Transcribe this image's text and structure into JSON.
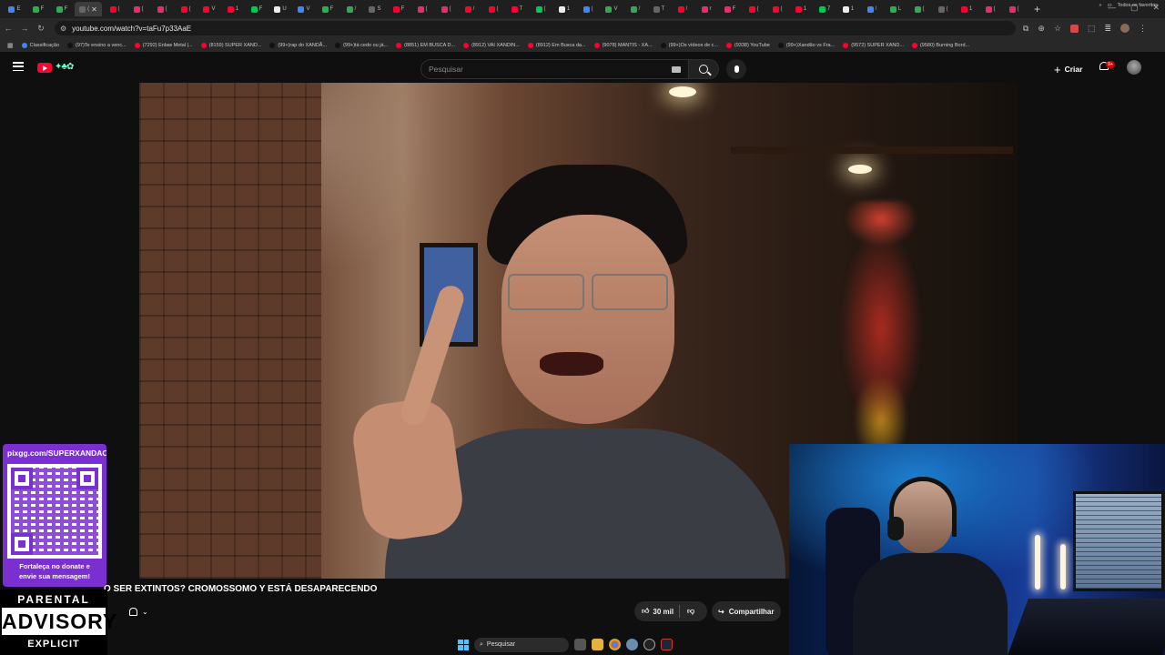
{
  "browser": {
    "tab_labels": [
      "E",
      "F",
      "F",
      "(",
      "(",
      "(",
      "(",
      "(",
      "V",
      "1",
      "F",
      "U",
      "V",
      "F",
      "/",
      "S",
      "F",
      "(",
      "(",
      "/",
      "(",
      "T",
      "(",
      "1",
      "(",
      "V",
      "/",
      "T",
      "/",
      "r",
      "F",
      "(",
      "(",
      "1",
      "7",
      "1",
      "/",
      "L",
      "(",
      "(",
      "1",
      "(",
      "("
    ],
    "active_tab_close": "✕",
    "new_tab": "+",
    "url": "youtube.com/watch?v=taFu7p33AaE",
    "bookmarks": [
      {
        "label": "Classificação",
        "color": "#4285f4"
      },
      {
        "label": "(97)Te ensino a venc...",
        "color": "#111111"
      },
      {
        "label": "(7292) Enlaw Metal |...",
        "color": "#ff0033"
      },
      {
        "label": "(8159) SUPER XAND...",
        "color": "#ff0033"
      },
      {
        "label": "(99+)rap do XANDÃ...",
        "color": "#111111"
      },
      {
        "label": "(99+)tá cedo ou já...",
        "color": "#111111"
      },
      {
        "label": "(8851) EM BUSCA D...",
        "color": "#ff0033"
      },
      {
        "label": "(8912) VAI XANDIN...",
        "color": "#ff0033"
      },
      {
        "label": "(8912) Em Busca da...",
        "color": "#ff0033"
      },
      {
        "label": "(9078) MANTIS - XA...",
        "color": "#ff0033"
      },
      {
        "label": "(99+)Os vídeos de c...",
        "color": "#111111"
      },
      {
        "label": "(9338) YouTube",
        "color": "#ff0033"
      },
      {
        "label": "(99+)Xandão vs Fra...",
        "color": "#111111"
      },
      {
        "label": "(9572) SUPER XAND...",
        "color": "#ff0033"
      },
      {
        "label": "(9580) Burning Bord...",
        "color": "#ff0033"
      }
    ],
    "all_bookmarks": "Todos os favoritos"
  },
  "youtube": {
    "search_placeholder": "Pesquisar",
    "create_label": "Criar",
    "notif_badge": "9+",
    "video_title": "O SER EXTINTOS? CROMOSSOMO Y ESTÁ DESAPARECENDO",
    "likes": "30 mil",
    "share_label": "Compartilhar"
  },
  "overlay": {
    "donate_link": "pixgg.com/SUPERXANDAO",
    "donate_msg_line1": "Fortaleça no donate e",
    "donate_msg_line2": "envie sua mensagem!",
    "advisory_top": "PARENTAL",
    "advisory_mid": "ADVISORY",
    "advisory_bottom": "EXPLICIT CONTENT"
  },
  "taskbar": {
    "search_label": "Pesquisar"
  },
  "colors": {
    "yt_red": "#ff0033",
    "pix_purple": "#7a2fd0",
    "windows_blue": "#4cc2ff"
  }
}
